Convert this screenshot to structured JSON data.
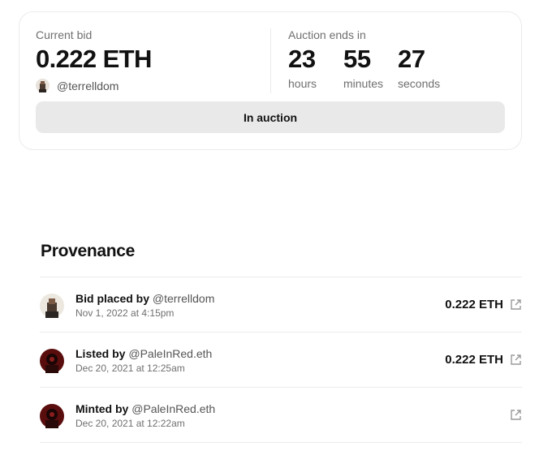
{
  "bid": {
    "label": "Current bid",
    "amount": "0.222 ETH",
    "bidder": "@terrelldom"
  },
  "auction": {
    "label": "Auction ends in",
    "countdown": [
      {
        "value": "23",
        "unit": "hours"
      },
      {
        "value": "55",
        "unit": "minutes"
      },
      {
        "value": "27",
        "unit": "seconds"
      }
    ],
    "button_label": "In auction"
  },
  "provenance": {
    "title": "Provenance",
    "events": [
      {
        "action": "Bid placed by",
        "actor": "@terrelldom",
        "date": "Nov 1, 2022 at 4:15pm",
        "amount": "0.222 ETH"
      },
      {
        "action": "Listed by",
        "actor": "@PaleInRed.eth",
        "date": "Dec 20, 2021 at 12:25am",
        "amount": "0.222 ETH"
      },
      {
        "action": "Minted by",
        "actor": "@PaleInRed.eth",
        "date": "Dec 20, 2021 at 12:22am",
        "amount": ""
      }
    ]
  },
  "icons": {
    "external": "external-link-icon"
  },
  "colors": {
    "muted_text": "#6f6f6f",
    "button_bg": "#e9e9e9",
    "border": "#ebebeb"
  }
}
